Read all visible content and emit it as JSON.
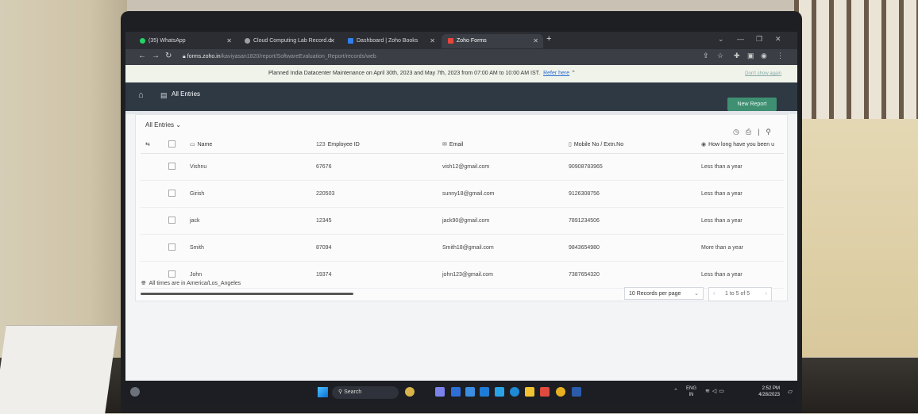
{
  "browser": {
    "tabs": [
      {
        "label": "(35) WhatsApp",
        "icon": "whatsapp-icon",
        "color": "#25d366"
      },
      {
        "label": "Cloud Computing Lab Record.d",
        "icon": "globe-icon",
        "color": "#9aa0a6"
      },
      {
        "label": "Dashboard | Zoho Books",
        "icon": "zoho-books-icon",
        "color": "#2f80ed"
      },
      {
        "label": "Zoho Forms",
        "icon": "zoho-forms-icon",
        "color": "#e8453c",
        "active": true
      }
    ],
    "url_host": "forms.zoho.in",
    "url_path": "/kaviyasan1820/report/SoftwareEvaluation_Report/records/web"
  },
  "notice": {
    "message": "Planned India Datacenter Maintenance on April 30th, 2023 and May 7th, 2023 from 07:00 AM to 10:00 AM IST.",
    "link": "Refer here",
    "dismiss": "Don't show again"
  },
  "app": {
    "title": "All Entries",
    "new_report": "New Report",
    "view_select": "All Entries"
  },
  "table": {
    "columns": [
      {
        "icon": "text-field-icon",
        "prefix": "",
        "label": "Name"
      },
      {
        "icon": "number-field-icon",
        "prefix": "123",
        "label": "Employee ID"
      },
      {
        "icon": "email-icon",
        "prefix": "",
        "label": "Email"
      },
      {
        "icon": "phone-icon",
        "prefix": "",
        "label": "Mobile No / Extn.No"
      },
      {
        "icon": "radio-icon",
        "prefix": "",
        "label": "How long have you been u"
      }
    ],
    "rows": [
      {
        "name": "Vishnu",
        "emp_id": "67676",
        "email": "vish12@gmail.com",
        "mobile": "90908783965",
        "duration": "Less than a year"
      },
      {
        "name": "Girish",
        "emp_id": "220503",
        "email": "sunny18@gmail.com",
        "mobile": "9126308756",
        "duration": "Less than a year"
      },
      {
        "name": "jack",
        "emp_id": "12345",
        "email": "jack90@gmail.com",
        "mobile": "7891234506",
        "duration": "Less than a year"
      },
      {
        "name": "Smith",
        "emp_id": "87094",
        "email": "Smith18@gmail.com",
        "mobile": "9843654980",
        "duration": "More than a year"
      },
      {
        "name": "John",
        "emp_id": "19374",
        "email": "john123@gmail.com",
        "mobile": "7387654320",
        "duration": "Less than a year"
      }
    ]
  },
  "footer": {
    "timezone": "All times are in America/Los_Angeles",
    "per_page": "10 Records per page",
    "pagination": "1 to 5 of 5"
  },
  "taskbar": {
    "search": "Search",
    "lang_top": "ENG",
    "lang_bottom": "IN",
    "time": "2:52 PM",
    "date": "4/28/2023"
  }
}
